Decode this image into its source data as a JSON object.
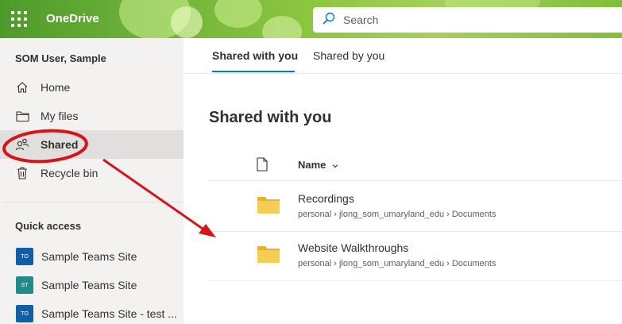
{
  "header": {
    "app_name": "OneDrive",
    "search_placeholder": "Search",
    "waffle_icon": "app-launcher-icon"
  },
  "sidebar": {
    "user_name": "SOM User, Sample",
    "nav": [
      {
        "label": "Home",
        "icon": "home-icon",
        "selected": false
      },
      {
        "label": "My files",
        "icon": "folder-icon",
        "selected": false
      },
      {
        "label": "Shared",
        "icon": "people-icon",
        "selected": true
      },
      {
        "label": "Recycle bin",
        "icon": "trash-icon",
        "selected": false
      }
    ],
    "quick_access_title": "Quick access",
    "quick_access": [
      {
        "label": "Sample Teams Site",
        "badge": "TO",
        "color": "#0f5ea8"
      },
      {
        "label": "Sample Teams Site",
        "badge": "ST",
        "color": "#208b88"
      },
      {
        "label": "Sample Teams Site - test ...",
        "badge": "TO",
        "color": "#0f5ea8"
      }
    ]
  },
  "tabs": [
    {
      "label": "Shared with you",
      "active": true
    },
    {
      "label": "Shared by you",
      "active": false
    }
  ],
  "main": {
    "title": "Shared with you",
    "column_name": "Name",
    "files": [
      {
        "name": "Recordings",
        "path": "personal › jlong_som_umaryland_edu › Documents"
      },
      {
        "name": "Website Walkthroughs",
        "path": "personal › jlong_som_umaryland_edu › Documents"
      }
    ]
  },
  "colors": {
    "accent": "#0078d4",
    "annotation": "#d8141b",
    "folder": "#f0c043",
    "header_green": "#6fb33a"
  }
}
